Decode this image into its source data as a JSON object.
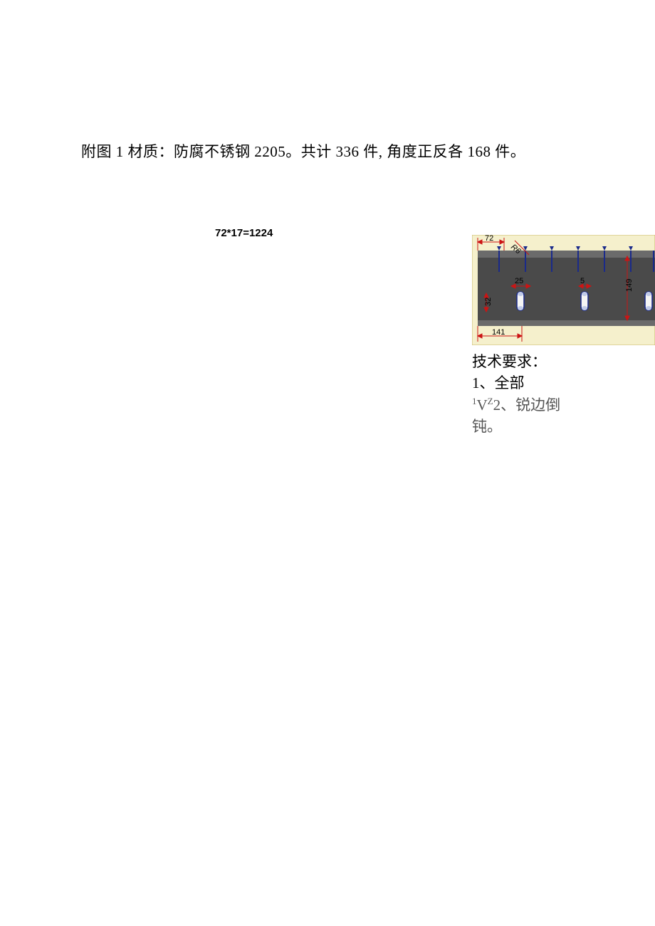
{
  "main_text": "附图 1 材质：防腐不锈钢 2205。共计 336 件, 角度正反各 168 件。",
  "formula": "72*17=1224",
  "dimensions": {
    "d72": "72",
    "r6": "R6",
    "d25": "25",
    "d5": "5",
    "d149": "149",
    "d32": "32",
    "d141": "141"
  },
  "notes": {
    "heading": "技术要求：",
    "item1": "1、全部",
    "item2_prefix_sup": "1",
    "item2_mid": "V",
    "item2_sup2": "Z",
    "item2_rest": "2、锐边倒",
    "item3": "钝。"
  }
}
